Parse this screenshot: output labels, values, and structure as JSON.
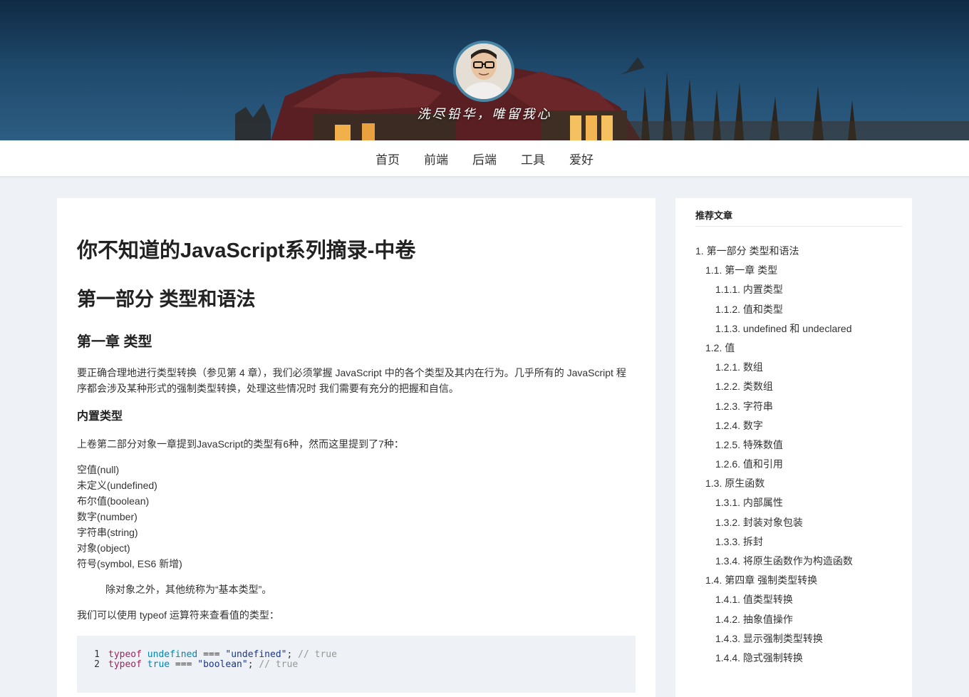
{
  "header": {
    "motto": "洗尽铅华，唯留我心"
  },
  "nav": {
    "items": [
      "首页",
      "前端",
      "后端",
      "工具",
      "爱好"
    ]
  },
  "article": {
    "title": "你不知道的JavaScript系列摘录-中卷",
    "part": "第一部分 类型和语法",
    "chapter": "第一章 类型",
    "intro": "要正确合理地进行类型转换（参见第 4 章），我们必须掌握 JavaScript 中的各个类型及其内在行为。几乎所有的 JavaScript 程序都会涉及某种形式的强制类型转换，处理这些情况时 我们需要有充分的把握和自信。",
    "section": "内置类型",
    "note": "上卷第二部分对象一章提到JavaScript的类型有6种，然而这里提到了7种：",
    "types": [
      "空值(null)",
      "未定义(undefined)",
      "布尔值(boolean)",
      "数字(number)",
      "字符串(string)",
      "对象(object)",
      "符号(symbol, ES6 新增)"
    ],
    "basic": "除对象之外，其他统称为“基本类型”。",
    "typeof_note": "我们可以使用 typeof 运算符来查看值的类型：",
    "code": [
      {
        "ln": "1",
        "kw": "typeof",
        "val": "undefined",
        "op": " === ",
        "str": "\"undefined\"",
        "end": "; ",
        "comment": "// true"
      },
      {
        "ln": "2",
        "kw": "typeof",
        "val": "true",
        "op": " === ",
        "str": "\"boolean\"",
        "end": "; ",
        "comment": "// true"
      }
    ]
  },
  "sidebar": {
    "title": "推荐文章",
    "toc": [
      {
        "level": 1,
        "label": "1. 第一部分 类型和语法"
      },
      {
        "level": 2,
        "label": "1.1. 第一章 类型"
      },
      {
        "level": 3,
        "label": "1.1.1. 内置类型"
      },
      {
        "level": 3,
        "label": "1.1.2. 值和类型"
      },
      {
        "level": 3,
        "label": "1.1.3. undefined 和 undeclared"
      },
      {
        "level": 2,
        "label": "1.2. 值"
      },
      {
        "level": 3,
        "label": "1.2.1. 数组"
      },
      {
        "level": 3,
        "label": "1.2.2. 类数组"
      },
      {
        "level": 3,
        "label": "1.2.3. 字符串"
      },
      {
        "level": 3,
        "label": "1.2.4. 数字"
      },
      {
        "level": 3,
        "label": "1.2.5. 特殊数值"
      },
      {
        "level": 3,
        "label": "1.2.6. 值和引用"
      },
      {
        "level": 2,
        "label": "1.3. 原生函数"
      },
      {
        "level": 3,
        "label": "1.3.1. 内部属性"
      },
      {
        "level": 3,
        "label": "1.3.2. 封装对象包装"
      },
      {
        "level": 3,
        "label": "1.3.3. 拆封"
      },
      {
        "level": 3,
        "label": "1.3.4. 将原生函数作为构造函数"
      },
      {
        "level": 2,
        "label": "1.4. 第四章 强制类型转换"
      },
      {
        "level": 3,
        "label": "1.4.1. 值类型转换"
      },
      {
        "level": 3,
        "label": "1.4.2. 抽象值操作"
      },
      {
        "level": 3,
        "label": "1.4.3. 显示强制类型转换"
      },
      {
        "level": 3,
        "label": "1.4.4. 隐式强制转换"
      }
    ]
  }
}
